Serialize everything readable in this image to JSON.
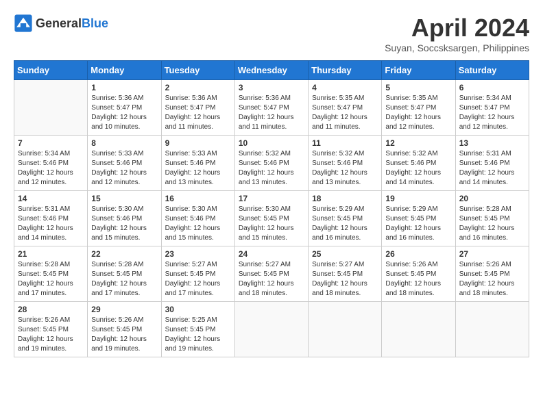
{
  "header": {
    "logo_general": "General",
    "logo_blue": "Blue",
    "month_title": "April 2024",
    "location": "Suyan, Soccsksargen, Philippines"
  },
  "days_of_week": [
    "Sunday",
    "Monday",
    "Tuesday",
    "Wednesday",
    "Thursday",
    "Friday",
    "Saturday"
  ],
  "weeks": [
    [
      {
        "day": "",
        "info": ""
      },
      {
        "day": "1",
        "info": "Sunrise: 5:36 AM\nSunset: 5:47 PM\nDaylight: 12 hours\nand 10 minutes."
      },
      {
        "day": "2",
        "info": "Sunrise: 5:36 AM\nSunset: 5:47 PM\nDaylight: 12 hours\nand 11 minutes."
      },
      {
        "day": "3",
        "info": "Sunrise: 5:36 AM\nSunset: 5:47 PM\nDaylight: 12 hours\nand 11 minutes."
      },
      {
        "day": "4",
        "info": "Sunrise: 5:35 AM\nSunset: 5:47 PM\nDaylight: 12 hours\nand 11 minutes."
      },
      {
        "day": "5",
        "info": "Sunrise: 5:35 AM\nSunset: 5:47 PM\nDaylight: 12 hours\nand 12 minutes."
      },
      {
        "day": "6",
        "info": "Sunrise: 5:34 AM\nSunset: 5:47 PM\nDaylight: 12 hours\nand 12 minutes."
      }
    ],
    [
      {
        "day": "7",
        "info": "Sunrise: 5:34 AM\nSunset: 5:46 PM\nDaylight: 12 hours\nand 12 minutes."
      },
      {
        "day": "8",
        "info": "Sunrise: 5:33 AM\nSunset: 5:46 PM\nDaylight: 12 hours\nand 12 minutes."
      },
      {
        "day": "9",
        "info": "Sunrise: 5:33 AM\nSunset: 5:46 PM\nDaylight: 12 hours\nand 13 minutes."
      },
      {
        "day": "10",
        "info": "Sunrise: 5:32 AM\nSunset: 5:46 PM\nDaylight: 12 hours\nand 13 minutes."
      },
      {
        "day": "11",
        "info": "Sunrise: 5:32 AM\nSunset: 5:46 PM\nDaylight: 12 hours\nand 13 minutes."
      },
      {
        "day": "12",
        "info": "Sunrise: 5:32 AM\nSunset: 5:46 PM\nDaylight: 12 hours\nand 14 minutes."
      },
      {
        "day": "13",
        "info": "Sunrise: 5:31 AM\nSunset: 5:46 PM\nDaylight: 12 hours\nand 14 minutes."
      }
    ],
    [
      {
        "day": "14",
        "info": "Sunrise: 5:31 AM\nSunset: 5:46 PM\nDaylight: 12 hours\nand 14 minutes."
      },
      {
        "day": "15",
        "info": "Sunrise: 5:30 AM\nSunset: 5:46 PM\nDaylight: 12 hours\nand 15 minutes."
      },
      {
        "day": "16",
        "info": "Sunrise: 5:30 AM\nSunset: 5:46 PM\nDaylight: 12 hours\nand 15 minutes."
      },
      {
        "day": "17",
        "info": "Sunrise: 5:30 AM\nSunset: 5:45 PM\nDaylight: 12 hours\nand 15 minutes."
      },
      {
        "day": "18",
        "info": "Sunrise: 5:29 AM\nSunset: 5:45 PM\nDaylight: 12 hours\nand 16 minutes."
      },
      {
        "day": "19",
        "info": "Sunrise: 5:29 AM\nSunset: 5:45 PM\nDaylight: 12 hours\nand 16 minutes."
      },
      {
        "day": "20",
        "info": "Sunrise: 5:28 AM\nSunset: 5:45 PM\nDaylight: 12 hours\nand 16 minutes."
      }
    ],
    [
      {
        "day": "21",
        "info": "Sunrise: 5:28 AM\nSunset: 5:45 PM\nDaylight: 12 hours\nand 17 minutes."
      },
      {
        "day": "22",
        "info": "Sunrise: 5:28 AM\nSunset: 5:45 PM\nDaylight: 12 hours\nand 17 minutes."
      },
      {
        "day": "23",
        "info": "Sunrise: 5:27 AM\nSunset: 5:45 PM\nDaylight: 12 hours\nand 17 minutes."
      },
      {
        "day": "24",
        "info": "Sunrise: 5:27 AM\nSunset: 5:45 PM\nDaylight: 12 hours\nand 18 minutes."
      },
      {
        "day": "25",
        "info": "Sunrise: 5:27 AM\nSunset: 5:45 PM\nDaylight: 12 hours\nand 18 minutes."
      },
      {
        "day": "26",
        "info": "Sunrise: 5:26 AM\nSunset: 5:45 PM\nDaylight: 12 hours\nand 18 minutes."
      },
      {
        "day": "27",
        "info": "Sunrise: 5:26 AM\nSunset: 5:45 PM\nDaylight: 12 hours\nand 18 minutes."
      }
    ],
    [
      {
        "day": "28",
        "info": "Sunrise: 5:26 AM\nSunset: 5:45 PM\nDaylight: 12 hours\nand 19 minutes."
      },
      {
        "day": "29",
        "info": "Sunrise: 5:26 AM\nSunset: 5:45 PM\nDaylight: 12 hours\nand 19 minutes."
      },
      {
        "day": "30",
        "info": "Sunrise: 5:25 AM\nSunset: 5:45 PM\nDaylight: 12 hours\nand 19 minutes."
      },
      {
        "day": "",
        "info": ""
      },
      {
        "day": "",
        "info": ""
      },
      {
        "day": "",
        "info": ""
      },
      {
        "day": "",
        "info": ""
      }
    ]
  ]
}
